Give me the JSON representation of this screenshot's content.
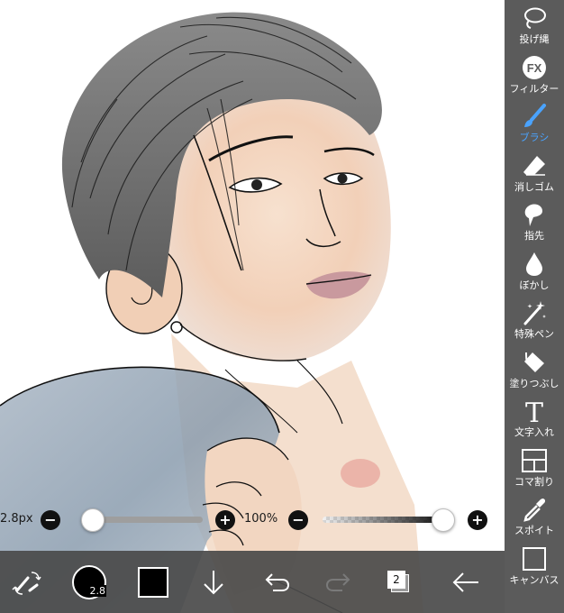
{
  "tools": [
    {
      "id": "lasso",
      "label": "投げ縄",
      "icon": "lasso-icon"
    },
    {
      "id": "filter",
      "label": "フィルター",
      "icon": "fx-icon"
    },
    {
      "id": "brush",
      "label": "ブラシ",
      "icon": "brush-icon",
      "active": true
    },
    {
      "id": "eraser",
      "label": "消しゴム",
      "icon": "eraser-icon"
    },
    {
      "id": "smudge",
      "label": "指先",
      "icon": "smudge-icon"
    },
    {
      "id": "blur",
      "label": "ぼかし",
      "icon": "blur-drop-icon"
    },
    {
      "id": "special",
      "label": "特殊ペン",
      "icon": "magic-pen-icon"
    },
    {
      "id": "fill",
      "label": "塗りつぶし",
      "icon": "fill-bucket-icon"
    },
    {
      "id": "text",
      "label": "文字入れ",
      "icon": "text-t-icon"
    },
    {
      "id": "frame",
      "label": "コマ割り",
      "icon": "frame-divider-icon"
    },
    {
      "id": "eyedropper",
      "label": "スポイト",
      "icon": "eyedropper-icon"
    },
    {
      "id": "canvas",
      "label": "キャンバス",
      "icon": "canvas-icon"
    }
  ],
  "brush_size": {
    "text": "2.8px",
    "minus": "−",
    "plus": "+",
    "level": 0.0
  },
  "opacity": {
    "text": "100%",
    "minus": "−",
    "plus": "+",
    "level": 1.0
  },
  "bottom": {
    "brush_size_badge": "2.8",
    "layer_count": "2",
    "color": "#000000",
    "accent": "#4aa3ff"
  }
}
